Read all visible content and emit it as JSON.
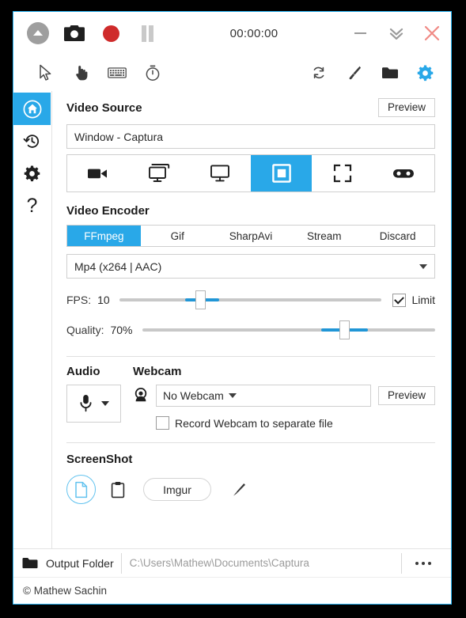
{
  "window": {
    "accent_color": "#29a8e8",
    "border_color": "#29b6f6",
    "background_color": "#ffffff"
  },
  "titlebar": {
    "timer": "00:00:00",
    "buttons": [
      {
        "name": "circle-up-icon",
        "label": ""
      },
      {
        "name": "camera-icon",
        "label": ""
      },
      {
        "name": "record-icon",
        "label": ""
      },
      {
        "name": "pause-icon",
        "label": ""
      }
    ],
    "window_controls": [
      {
        "name": "minimize-icon",
        "label": ""
      },
      {
        "name": "double-chevron-down-icon",
        "label": ""
      },
      {
        "name": "close-icon",
        "label": "✕"
      }
    ],
    "close_color": "#f08a85"
  },
  "toolbar": {
    "left_icons": [
      "cursor-icon",
      "click-hand-icon",
      "keyboard-icon",
      "stopwatch-icon"
    ],
    "right_icons": [
      "refresh-icon",
      "brush-icon",
      "folder-icon",
      "gear-icon"
    ],
    "gear_color": "#29a8e8"
  },
  "sidebar": {
    "items": [
      {
        "name": "sidebar-item-home",
        "icon": "home-icon",
        "active": true
      },
      {
        "name": "sidebar-item-history",
        "icon": "history-icon",
        "active": false
      },
      {
        "name": "sidebar-item-settings",
        "icon": "gear-icon",
        "active": false
      },
      {
        "name": "sidebar-item-help",
        "icon": "question-icon",
        "label": "?",
        "active": false
      }
    ]
  },
  "video_source": {
    "heading": "Video Source",
    "preview_label": "Preview",
    "selected_source": "Window  -  Captura",
    "source_buttons": [
      {
        "name": "source-camcorder",
        "icon": "camcorder-icon",
        "active": false
      },
      {
        "name": "source-all-screens",
        "icon": "multi-screen-icon",
        "active": false
      },
      {
        "name": "source-screen",
        "icon": "monitor-icon",
        "active": false
      },
      {
        "name": "source-window",
        "icon": "window-icon",
        "active": true
      },
      {
        "name": "source-region",
        "icon": "crop-region-icon",
        "active": false
      },
      {
        "name": "source-game",
        "icon": "gamepad-icon",
        "active": false
      }
    ]
  },
  "video_encoder": {
    "heading": "Video Encoder",
    "tabs": [
      {
        "label": "FFmpeg",
        "active": true
      },
      {
        "label": "Gif",
        "active": false
      },
      {
        "label": "SharpAvi",
        "active": false
      },
      {
        "label": "Stream",
        "active": false
      },
      {
        "label": "Discard",
        "active": false
      }
    ],
    "format": "Mp4 (x264 | AAC)",
    "fps": {
      "label": "FPS:",
      "value": "10",
      "thumb_pct": 31,
      "fill_start_pct": 25,
      "fill_end_pct": 38
    },
    "limit": {
      "label": "Limit",
      "checked": true
    },
    "quality": {
      "label": "Quality:",
      "value": "70%",
      "thumb_pct": 69,
      "fill_start_pct": 61,
      "fill_end_pct": 77
    }
  },
  "audio": {
    "heading": "Audio",
    "mic_icon": "microphone-icon"
  },
  "webcam": {
    "heading": "Webcam",
    "icon": "webcam-icon",
    "selected": "No Webcam",
    "preview_label": "Preview",
    "separate_file_label": "Record Webcam to separate file",
    "separate_file_checked": false
  },
  "screenshot": {
    "heading": "ScreenShot",
    "targets": [
      {
        "name": "screenshot-to-file",
        "icon": "document-icon",
        "active": true
      },
      {
        "name": "screenshot-to-clipboard",
        "icon": "clipboard-icon",
        "active": false
      }
    ],
    "imgur_label": "Imgur",
    "edit_icon": "pencil-icon",
    "active_color": "#63c3ef"
  },
  "footer": {
    "folder_icon": "folder-icon",
    "output_label": "Output Folder",
    "output_path": "C:\\Users\\Mathew\\Documents\\Captura",
    "browse_icon": "ellipsis-icon",
    "copyright": "© Mathew Sachin"
  }
}
